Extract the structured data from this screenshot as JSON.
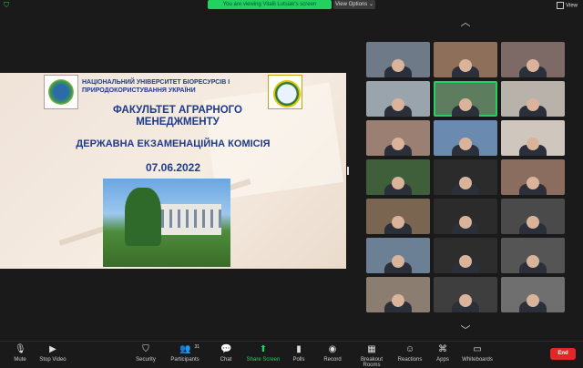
{
  "topbar": {
    "viewing_label": "You are viewing Vitalii Lutsiak's screen",
    "view_options_label": "View Options ⌄",
    "view_label": "View"
  },
  "slide": {
    "university": "НАЦІОНАЛЬНИЙ УНІВЕРСИТЕТ БІОРЕСУРСІВ І ПРИРОДОКОРИСТУВАННЯ УКРАЇНИ",
    "faculty": "ФАКУЛЬТЕТ АГРАРНОГО МЕНЕДЖМЕНТУ",
    "commission": "ДЕРЖАВНА ЕКЗАМЕНАЦІЙНА КОМІСІЯ",
    "date": "07.06.2022"
  },
  "gallery": {
    "tile_colors": [
      "#6f7a88",
      "#8d6f5a",
      "#7d6a66",
      "#9aa4ad",
      "#5d7d5e",
      "#b8b2ab",
      "#9a7f72",
      "#6a8ab0",
      "#cfc7bd",
      "#3f5f3a",
      "#2b2b2b",
      "#8b6d60",
      "#7a6650",
      "#2b2b2b",
      "#4a4a4a",
      "#6b7f95",
      "#2d2d2d",
      "#555555",
      "#8b7d70",
      "#3e3e3e",
      "#6f6f6f"
    ]
  },
  "toolbar": {
    "mute": "Mute",
    "stop_video": "Stop Video",
    "security": "Security",
    "participants": "Participants",
    "participants_count": "31",
    "chat": "Chat",
    "share_screen": "Share Screen",
    "polls": "Polls",
    "record": "Record",
    "breakout_rooms": "Breakout Rooms",
    "reactions": "Reactions",
    "apps": "Apps",
    "whiteboards": "Whiteboards",
    "end": "End"
  },
  "colors": {
    "accent_green": "#23d160",
    "end_red": "#e02828",
    "slide_text": "#1f3a8c"
  }
}
